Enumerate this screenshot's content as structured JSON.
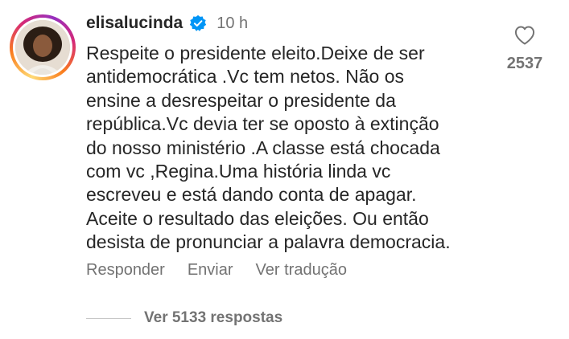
{
  "comment": {
    "username": "elisalucinda",
    "verified_icon": "verified-badge-icon",
    "time": "10 h",
    "text": "Respeite o presidente eleito.Deixe de ser\nantidemocrática .Vc tem netos. Não os\nensine a desrespeitar o presidente da\nrepública.Vc devia ter se oposto à extinção\ndo nosso ministério .A classe está chocada\ncom vc ,Regina.Uma história linda vc\nescreveu e está dando conta de apagar.\nAceite o resultado das eleições. Ou então\ndesista de pronunciar a palavra democracia.",
    "actions": {
      "reply": "Responder",
      "send": "Enviar",
      "translate": "Ver tradução"
    },
    "replies_label": "Ver 5133 respostas",
    "like_count": "2537"
  },
  "colors": {
    "primary_text": "#262626",
    "secondary_text": "#737373",
    "verified_blue": "#0095f6"
  }
}
